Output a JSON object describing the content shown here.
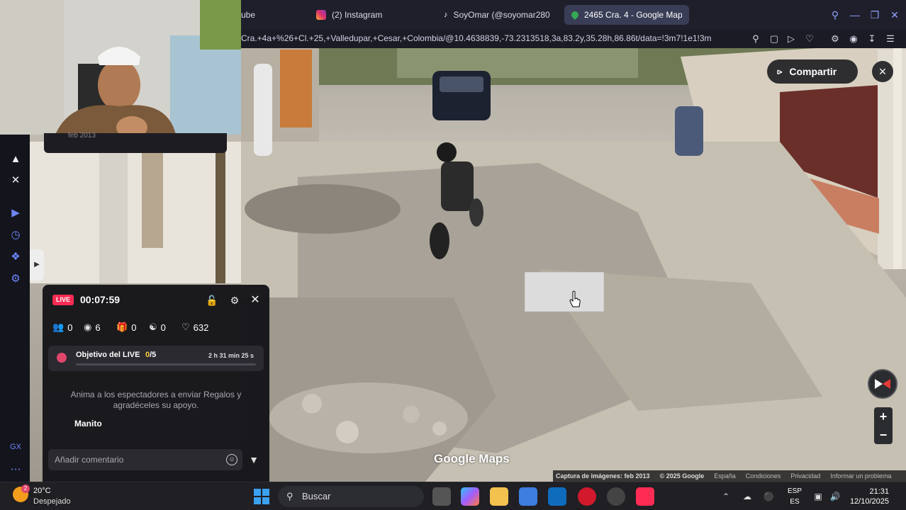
{
  "browser": {
    "tabs": [
      {
        "label": "ube",
        "active": false
      },
      {
        "label": "(2) Instagram",
        "active": false
      },
      {
        "label": "SoyOmar (@soyomar280",
        "active": false
      },
      {
        "label": "2465 Cra. 4 - Google Map",
        "active": true
      }
    ],
    "new_tab": "+",
    "url": "Cra.+4a+%26+Cl.+25,+Valledupar,+Cesar,+Colombia/@10.4638839,-73.2313518,3a,83.2y,35.28h,86.86t/data=!3m7!1e1!3m"
  },
  "webcam": {
    "strip_text": "feb 2013"
  },
  "streetview": {
    "share_label": "Compartir",
    "close": "×",
    "zoom_in": "+",
    "zoom_out": "−",
    "logo": "Google Maps",
    "footer": {
      "capture": "Captura de imágenes: feb 2013",
      "copyright": "© 2025 Google",
      "country": "España",
      "terms": "Condiciones",
      "privacy": "Privacidad",
      "report": "Informar un problema"
    }
  },
  "live_panel": {
    "badge": "LIVE",
    "timer": "00:07:59",
    "stats": {
      "members": "0",
      "viewers": "6",
      "gifts": "0",
      "shares": "0",
      "likes": "632"
    },
    "goal": {
      "label": "Objetivo del LIVE",
      "current": "0",
      "total": "/5",
      "time_left": "2 h 31 min 25 s",
      "progress": 0
    },
    "hint": "Anima a los espectadores a enviar Regalos y agradéceles su apoyo.",
    "comment_user": "Manito",
    "comment_placeholder": "Añadir comentario"
  },
  "taskbar": {
    "weather_badge": "2",
    "temperature": "20°C",
    "weather_desc": "Despejado",
    "search_label": "Buscar",
    "lang_top": "ESP",
    "lang_bottom": "ES",
    "time": "21:31",
    "date": "12/10/2025"
  }
}
